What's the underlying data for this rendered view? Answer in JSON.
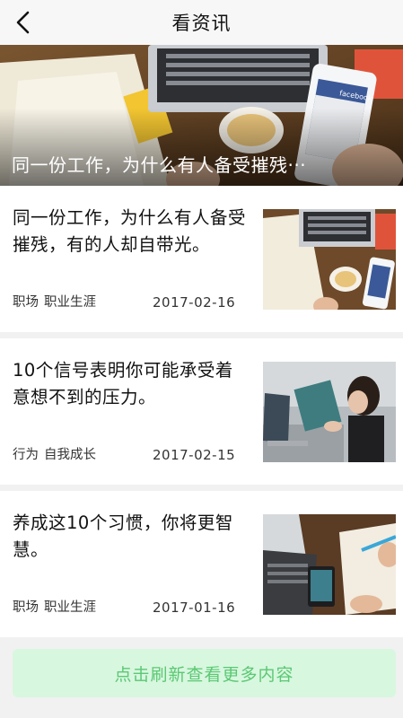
{
  "header": {
    "title": "看资讯",
    "back_icon": "chevron-left-icon"
  },
  "banner": {
    "caption": "同一份工作，为什么有人备受摧残···",
    "brand_text": "facebook"
  },
  "articles": [
    {
      "title": "同一份工作，为什么有人备受摧残，有的人却自带光。",
      "tags": [
        "职场",
        "职业生涯"
      ],
      "date": "2017-02-16"
    },
    {
      "title": "10个信号表明你可能承受着意想不到的压力。",
      "tags": [
        "行为",
        "自我成长"
      ],
      "date": "2017-02-15"
    },
    {
      "title": "养成这10个习惯，你将更智慧。",
      "tags": [
        "职场",
        "职业生涯"
      ],
      "date": "2017-01-16"
    }
  ],
  "footer": {
    "refresh_label": "点击刷新查看更多内容"
  },
  "colors": {
    "accent_green": "#5bc874",
    "refresh_bg": "#d8f7df",
    "nav_bg": "#f7f7f7"
  }
}
